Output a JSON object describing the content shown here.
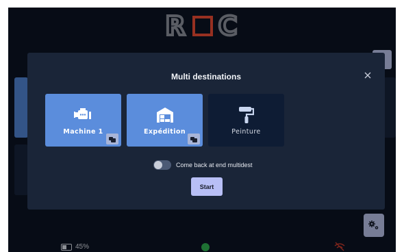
{
  "app": {
    "logo_text": "ROC"
  },
  "status": {
    "battery_percent": "45%",
    "battery_level": 0.45
  },
  "modal": {
    "title": "Multi destinations",
    "close_glyph": "×",
    "destinations": [
      {
        "label": "Machine 1",
        "icon": "machine-icon",
        "selected": true
      },
      {
        "label": "Expédition",
        "icon": "warehouse-icon",
        "selected": true
      },
      {
        "label": "Peinture",
        "icon": "paint-roller-icon",
        "selected": false
      }
    ],
    "toggle": {
      "label": "Come back at end multidest",
      "on": false
    },
    "start_label": "Start"
  },
  "colors": {
    "background": "#0b1322",
    "modal": "#1a2538",
    "tile_selected": "#5b8ddc",
    "tile_unselected": "#0e1c34",
    "start_button": "#b8bff6",
    "logo_accent": "#e84a34",
    "status_ok": "#2eae4f",
    "status_error": "#c0392b"
  }
}
